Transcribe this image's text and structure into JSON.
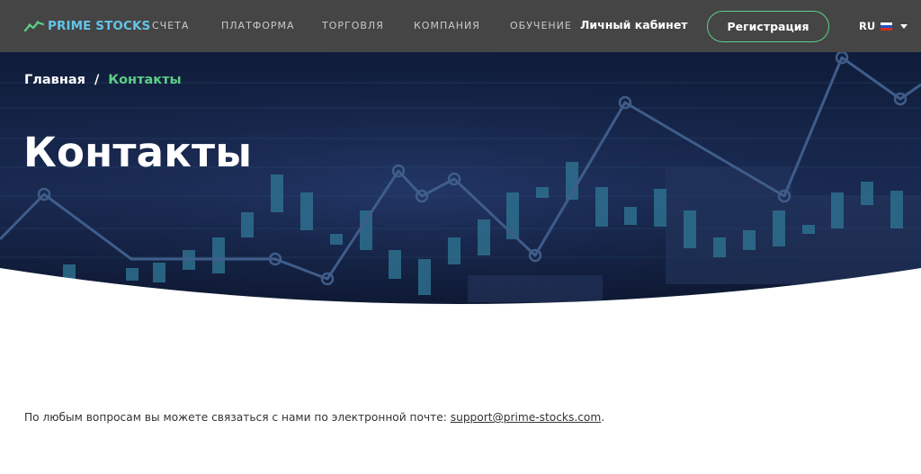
{
  "header": {
    "logo_text": "PRIME STOCKS",
    "nav": [
      {
        "label": "СЧЕТА"
      },
      {
        "label": "ПЛАТФОРМА"
      },
      {
        "label": "ТОРГОВЛЯ"
      },
      {
        "label": "КОМПАНИЯ"
      },
      {
        "label": "ОБУЧЕНИЕ"
      }
    ],
    "cabinet_label": "Личный кабинет",
    "register_label": "Регистрация",
    "language": "RU"
  },
  "breadcrumb": {
    "home": "Главная",
    "separator": "/",
    "current": "Контакты"
  },
  "page_title": "Контакты",
  "content": {
    "text_before": "По любым вопросам вы можете связаться с нами по электронной почте: ",
    "email": "support@prime-stocks.com",
    "text_after": "."
  },
  "colors": {
    "header_bg": "#454545",
    "accent_green": "#5ccf86",
    "logo_blue": "#62c4e8",
    "hero_bg": "#14213f"
  }
}
